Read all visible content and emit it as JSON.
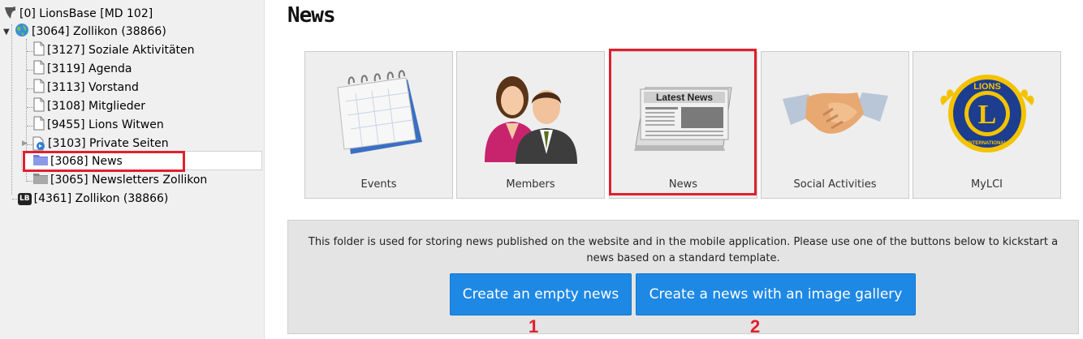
{
  "tree": {
    "root": "[0] LionsBase [MD 102]",
    "site": "[3064] Zollikon (38866)",
    "children": [
      "[3127] Soziale Aktivitäten",
      "[3119] Agenda",
      "[3113] Vorstand",
      "[3108] Mitglieder",
      "[9455] Lions Witwen"
    ],
    "private": "[3103] Private Seiten",
    "news": "[3068] News",
    "newsletters": "[3065] Newsletters Zollikon",
    "lb_root": "[4361] Zollikon (38866)",
    "lb_badge": "LB"
  },
  "main": {
    "title": "News",
    "tiles": [
      {
        "label": "Events",
        "icon": "calendar-icon"
      },
      {
        "label": "Members",
        "icon": "members-icon"
      },
      {
        "label": "News",
        "icon": "newspaper-icon",
        "icon_text": "Latest News"
      },
      {
        "label": "Social Activities",
        "icon": "handshake-icon"
      },
      {
        "label": "MyLCI",
        "icon": "lions-logo-icon"
      }
    ],
    "info_text": "This folder is used for storing news published on the website and in the mobile application. Please use one of the buttons below to kickstart a news based on a standard template.",
    "buttons": {
      "empty": "Create an empty news",
      "gallery": "Create a news with an image gallery"
    },
    "markers": [
      "1",
      "2"
    ],
    "logo_text": {
      "top": "LIONS",
      "center": "L",
      "bottom": "INTERNATIONAL"
    }
  },
  "colors": {
    "highlight": "#e0202e",
    "button": "#1e88e5",
    "tile_bg": "#eeeeee"
  }
}
